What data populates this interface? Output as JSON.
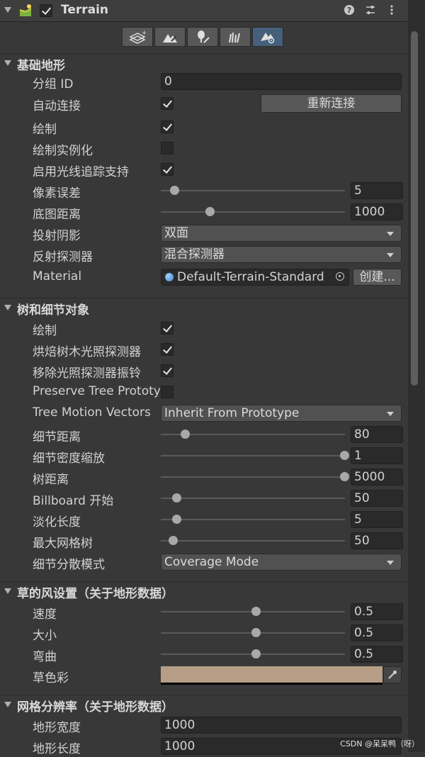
{
  "header": {
    "title": "Terrain",
    "enabled": true,
    "icons": [
      "help-icon",
      "preset-icon",
      "more-icon"
    ]
  },
  "toolbar": {
    "tools": [
      "create-neighbor-terrains",
      "paint-terrain",
      "paint-trees",
      "paint-details",
      "terrain-settings"
    ],
    "active_index": 4
  },
  "sections": {
    "basic": {
      "title": "基础地形",
      "group_id_label": "分组 ID",
      "group_id_value": "0",
      "auto_connect_label": "自动连接",
      "auto_connect": true,
      "reconnect_button": "重新连接",
      "draw_label": "绘制",
      "draw": true,
      "draw_instanced_label": "绘制实例化",
      "draw_instanced": false,
      "ray_tracing_label": "启用光线追踪支持",
      "ray_tracing": true,
      "pixel_error_label": "像素误差",
      "pixel_error_value": "5",
      "pixel_error_fraction": 0.04,
      "basemap_dist_label": "底图距离",
      "basemap_dist_value": "1000",
      "basemap_dist_fraction": 0.24,
      "cast_shadows_label": "投射阴影",
      "cast_shadows_value": "双面",
      "reflection_probes_label": "反射探测器",
      "reflection_probes_value": "混合探测器",
      "material_label": "Material",
      "material_value": "Default-Terrain-Standard",
      "create_button": "创建..."
    },
    "tree": {
      "title": "树和细节对象",
      "draw_label": "绘制",
      "draw": true,
      "bake_probes_label": "烘焙树木光照探测器",
      "bake_probes": true,
      "remove_ringing_label": "移除光照探测器振铃",
      "remove_ringing": true,
      "preserve_proto_label": "Preserve Tree Prototype Layers",
      "preserve_proto": false,
      "motion_vectors_label": "Tree Motion Vectors",
      "motion_vectors_value": "Inherit From Prototype",
      "detail_dist_label": "细节距离",
      "detail_dist_value": "80",
      "detail_dist_fraction": 0.1,
      "detail_density_label": "细节密度缩放",
      "detail_density_value": "1",
      "detail_density_fraction": 1.0,
      "tree_dist_label": "树距离",
      "tree_dist_value": "5000",
      "tree_dist_fraction": 1.0,
      "billboard_label": "Billboard 开始",
      "billboard_value": "50",
      "billboard_fraction": 0.05,
      "fade_label": "淡化长度",
      "fade_value": "5",
      "fade_fraction": 0.05,
      "max_mesh_label": "最大网格树",
      "max_mesh_value": "50",
      "max_mesh_fraction": 0.03,
      "scatter_label": "细节分散模式",
      "scatter_value": "Coverage Mode"
    },
    "wind": {
      "title": "草的风设置（关于地形数据）",
      "speed_label": "速度",
      "speed_value": "0.5",
      "speed_fraction": 0.5,
      "size_label": "大小",
      "size_value": "0.5",
      "size_fraction": 0.5,
      "bend_label": "弯曲",
      "bend_value": "0.5",
      "bend_fraction": 0.5,
      "tint_label": "草色彩",
      "tint_color": "#b59e85"
    },
    "mesh": {
      "title": "网格分辨率（关于地形数据）",
      "width_label": "地形宽度",
      "width_value": "1000",
      "length_label": "地形长度",
      "length_value": "1000"
    }
  },
  "watermark": "CSDN @呆呆鸭（呀）"
}
